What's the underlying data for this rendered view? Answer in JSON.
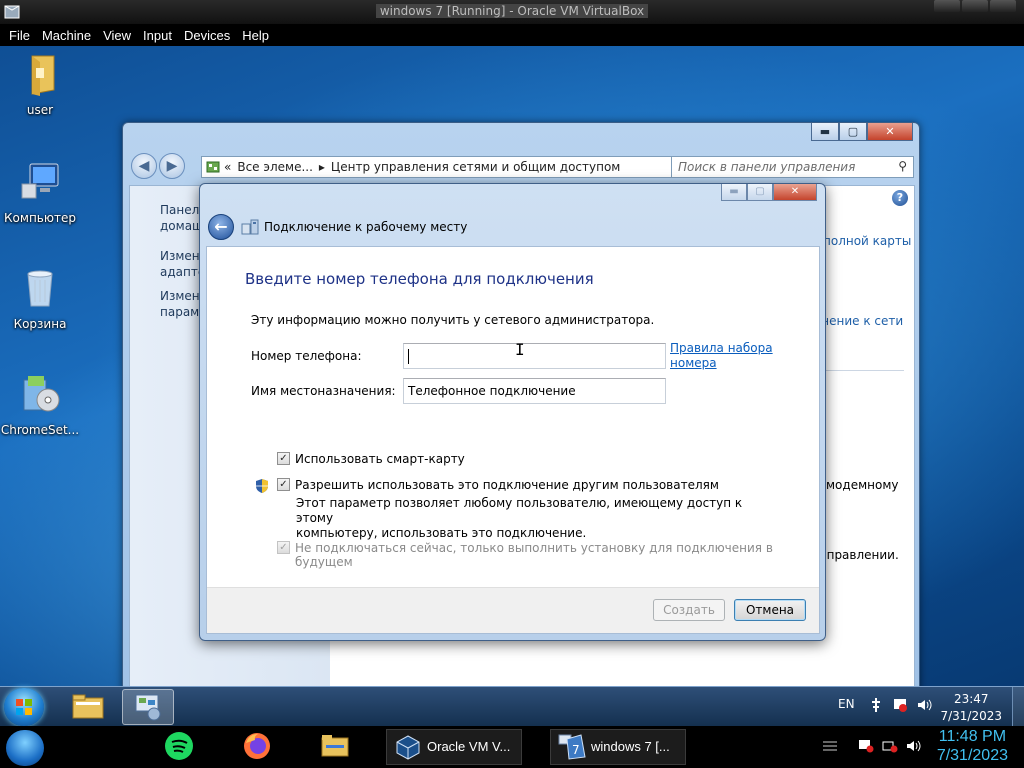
{
  "host": {
    "window_title": "windows 7 [Running] - Oracle VM VirtualBox",
    "menu": [
      "File",
      "Machine",
      "View",
      "Input",
      "Devices",
      "Help"
    ],
    "taskbar": {
      "tasks": [
        {
          "label": "Oracle VM V..."
        },
        {
          "label": "windows 7 [..."
        }
      ],
      "clock_time": "11:48 PM",
      "clock_date": "7/31/2023"
    }
  },
  "desktop_icons": [
    {
      "label": "user",
      "icon": "folder-icon"
    },
    {
      "label": "Компьютер",
      "icon": "computer-icon"
    },
    {
      "label": "Корзина",
      "icon": "recycle-bin-icon"
    },
    {
      "label": "ChromeSet...",
      "icon": "installer-icon"
    }
  ],
  "explorer": {
    "address": {
      "chevron": "«",
      "crumb1": "Все элеме...",
      "sep": "▸",
      "crumb2": "Центр управления сетями и общим доступом"
    },
    "search_placeholder": "Поиск в панели управления",
    "left_links": [
      {
        "line1": "Панель",
        "line2": "домаш"
      },
      {
        "line1": "Измене",
        "line2": "адаптер"
      },
      {
        "line1": "Измене",
        "line2": "парамет"
      }
    ],
    "right_fragments": {
      "map_link": "полной карты",
      "connect_link": "чение к сети",
      "modem_text": "модемному",
      "fix_text": "справлении."
    }
  },
  "wizard": {
    "title": "Подключение к рабочему месту",
    "heading": "Введите номер телефона для подключения",
    "info": "Эту информацию можно получить у сетевого администратора.",
    "phone_label": "Номер телефона:",
    "phone_value": "",
    "rules_link_line1": "Правила набора",
    "rules_link_line2": "номера",
    "dest_label": "Имя местоназначения:",
    "dest_value": "Телефонное подключение",
    "opt_smartcard": "Использовать смарт-карту",
    "opt_smartcard_checked": true,
    "opt_allow_others": "Разрешить использовать это подключение другим пользователям",
    "opt_allow_others_checked": true,
    "allow_desc_line1": "Этот параметр позволяет любому пользователю, имеющему доступ к этому",
    "allow_desc_line2": "компьютеру, использовать это подключение.",
    "opt_no_connect": "Не подключаться сейчас, только выполнить установку для подключения в будущем",
    "opt_no_connect_checked": true,
    "create_button": "Создать",
    "cancel_button": "Отмена"
  },
  "guest_taskbar": {
    "language": "EN",
    "clock_time": "23:47",
    "clock_date": "7/31/2023"
  },
  "colors": {
    "heading_blue": "#1e3287",
    "link_blue": "#0a5dbd",
    "host_clock": "#41c0f0"
  }
}
